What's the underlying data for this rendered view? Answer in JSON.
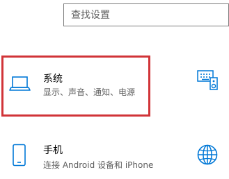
{
  "search": {
    "placeholder": "查找设置"
  },
  "tiles": [
    {
      "title": "系统",
      "description": "显示、声音、通知、电源",
      "icon": "laptop-icon",
      "selected": true
    },
    {
      "title": "手机",
      "description": "连接 Android 设备和 iPhone",
      "icon": "phone-icon",
      "selected": false
    }
  ],
  "edge_icons": [
    "devices-icon",
    "globe-icon"
  ],
  "colors": {
    "accent": "#0078d7",
    "selection_border": "#d13438",
    "description_text": "#5d5d5d"
  }
}
